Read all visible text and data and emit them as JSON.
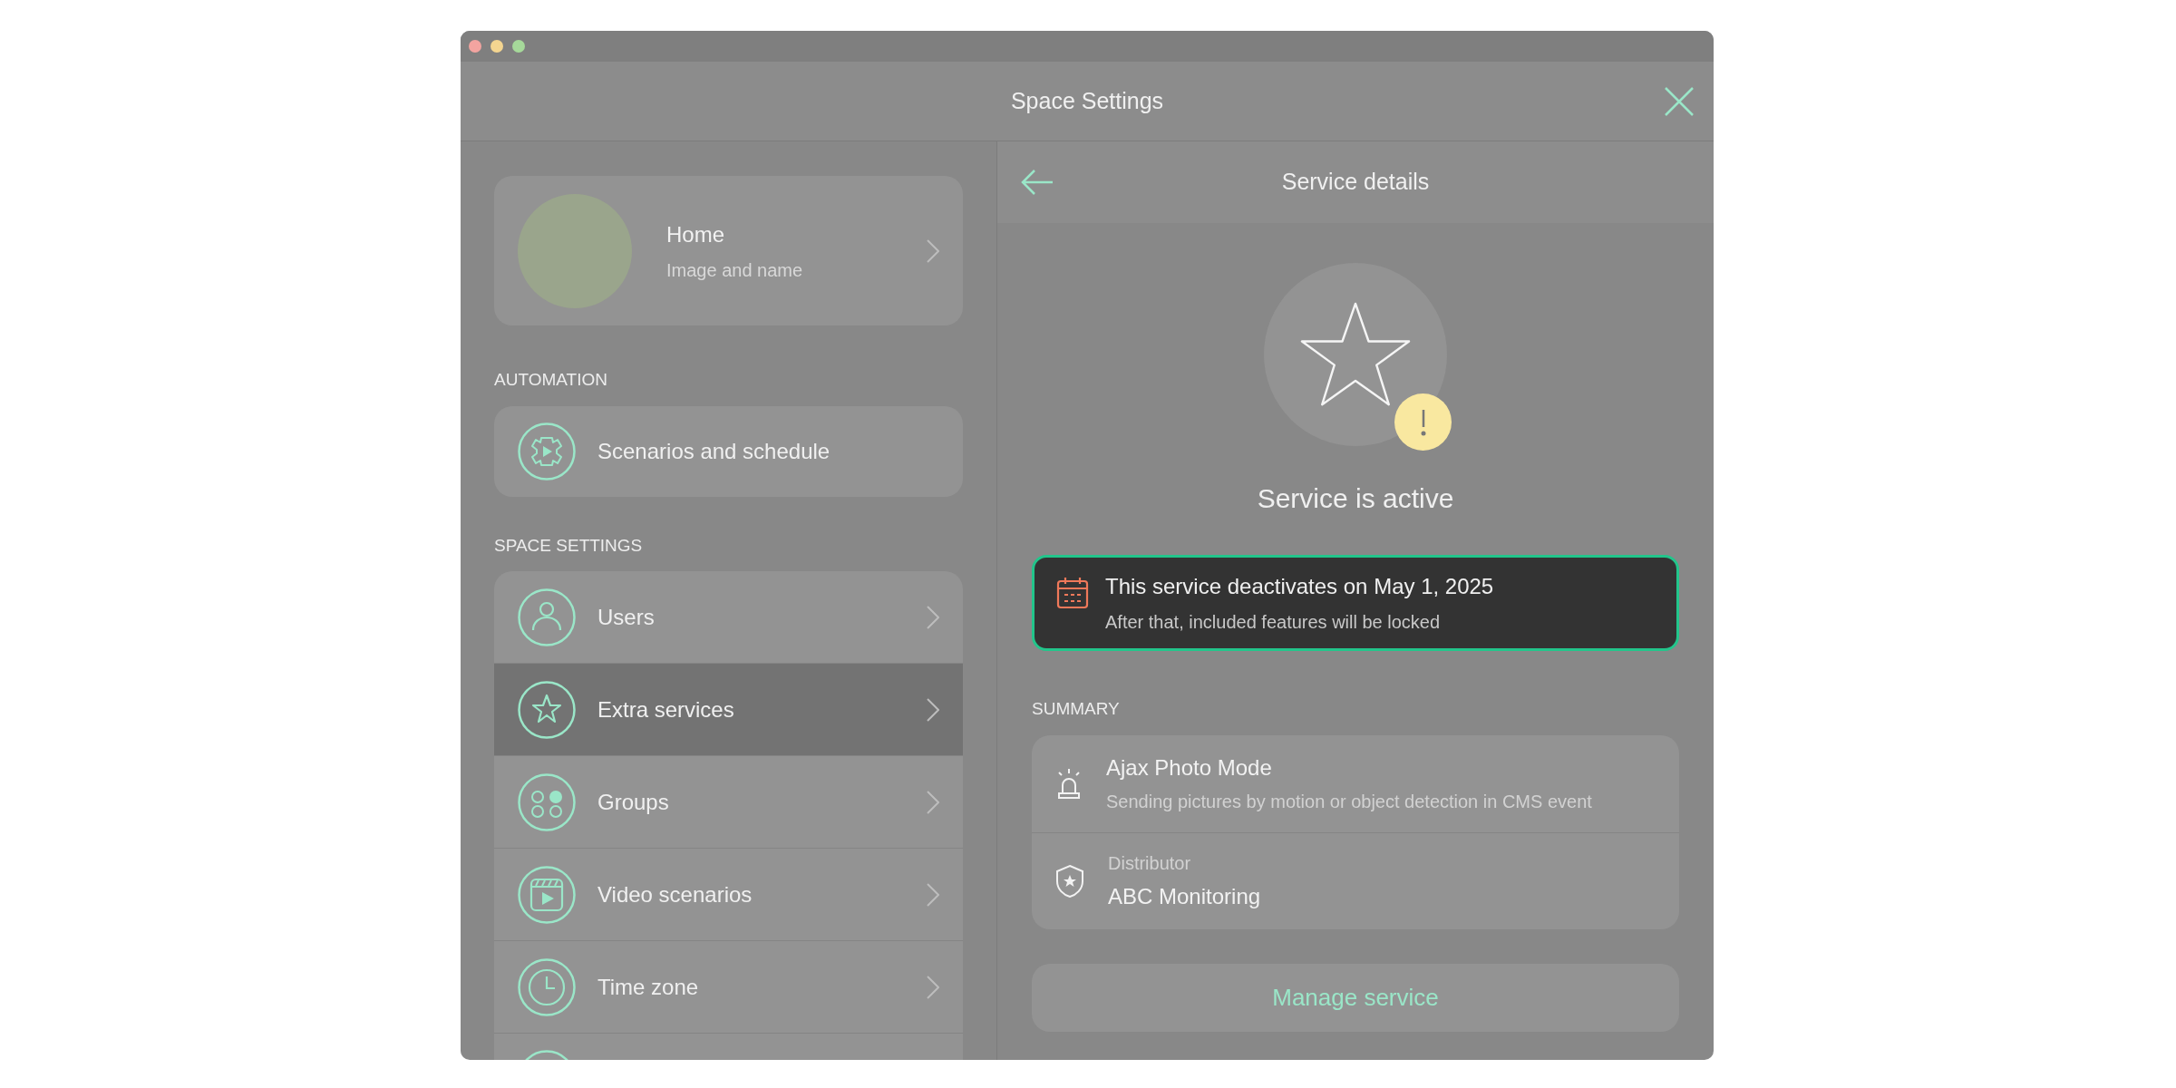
{
  "window": {
    "title": "Space Settings"
  },
  "space_card": {
    "name": "Home",
    "subtitle": "Image and name"
  },
  "automation": {
    "heading": "AUTOMATION",
    "items": [
      {
        "label": "Scenarios and schedule"
      }
    ]
  },
  "space_settings": {
    "heading": "SPACE SETTINGS",
    "items": [
      {
        "kind": "row",
        "label": "Users",
        "selected": false
      },
      {
        "kind": "row",
        "label": "Extra services",
        "selected": true
      },
      {
        "kind": "row",
        "label": "Groups",
        "selected": false
      },
      {
        "kind": "row",
        "label": "Video scenarios",
        "selected": false
      },
      {
        "kind": "row",
        "label": "Time zone",
        "selected": false
      },
      {
        "kind": "cut_off",
        "selected": false
      }
    ]
  },
  "detail": {
    "title": "Service details",
    "status": "Service is active",
    "notice": {
      "title": "This service deactivates on May 1, 2025",
      "text": "After that, included features will be locked"
    },
    "summary_heading": "SUMMARY",
    "summary": [
      {
        "kind": "feature",
        "title": "Ajax Photo Mode",
        "text": "Sending pictures by motion or object detection in CMS event"
      },
      {
        "kind": "provider",
        "caption": "Distributor",
        "title": "ABC Monitoring"
      }
    ],
    "button": "Manage service"
  }
}
